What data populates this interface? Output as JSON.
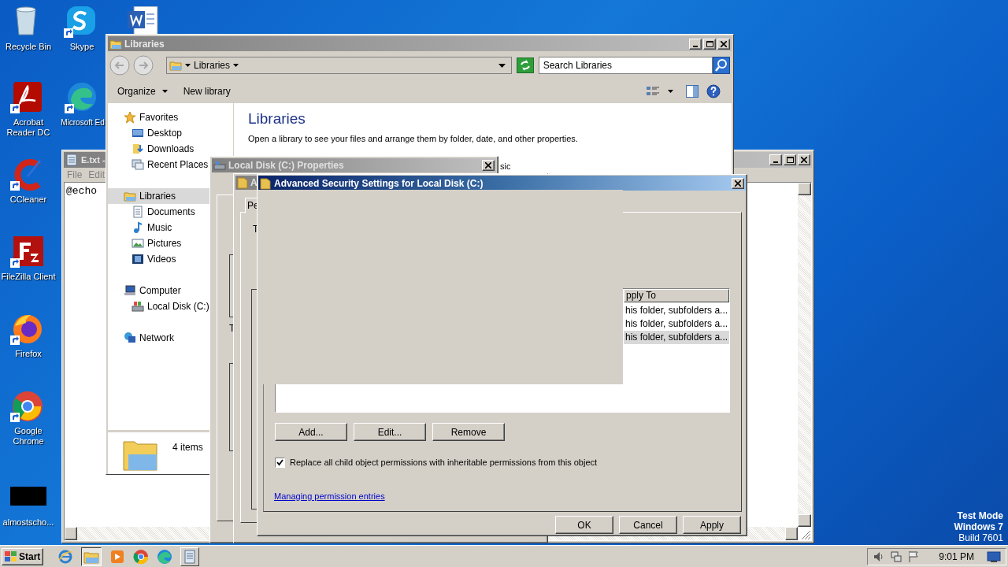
{
  "desktop_icons": [
    {
      "label": "Recycle Bin"
    },
    {
      "label": "Skype"
    },
    {
      "label": "Acrobat Reader DC"
    },
    {
      "label": "Microsoft Ed"
    },
    {
      "label": "CCleaner"
    },
    {
      "label": "FileZilla Client"
    },
    {
      "label": "Firefox"
    },
    {
      "label": "Google Chrome"
    },
    {
      "label": "almostscho..."
    }
  ],
  "notepad": {
    "title": "E.txt -",
    "menu": [
      "File",
      "Edit"
    ],
    "text": "@echo"
  },
  "explorer": {
    "title": "Libraries",
    "breadcrumb": "Libraries",
    "search": {
      "placeholder": "Search Libraries"
    },
    "toolbar": [
      "Organize",
      "New library"
    ],
    "nav": [
      {
        "label": "Favorites",
        "selected": false,
        "children": [
          {
            "label": "Desktop",
            "selected": false
          },
          {
            "label": "Downloads",
            "selected": false
          },
          {
            "label": "Recent Places",
            "selected": false
          }
        ]
      },
      {
        "label": "Libraries",
        "selected": true,
        "children": [
          {
            "label": "Documents",
            "selected": false
          },
          {
            "label": "Music",
            "selected": false
          },
          {
            "label": "Pictures",
            "selected": false
          },
          {
            "label": "Videos",
            "selected": false
          }
        ]
      },
      {
        "label": "Computer",
        "selected": false,
        "children": [
          {
            "label": "Local Disk (C:)",
            "selected": false
          }
        ]
      },
      {
        "label": "Network",
        "selected": false
      }
    ],
    "heading": "Libraries",
    "description": "Open a library to see your files and arrange them by folder, date, and other properties.",
    "content_fragment": "sic",
    "details": "4 items"
  },
  "properties_dialog": {
    "title": "Local Disk (C:) Properties",
    "fragments": [
      "T"
    ]
  },
  "middle_dialog": {
    "title": "A",
    "tab": "Pe",
    "fragments": [
      "T"
    ]
  },
  "advanced_dialog": {
    "title": "Advanced Security Settings for Local Disk (C:)",
    "column": "pply To",
    "rows": [
      {
        "apply_to": "his folder, subfolders a...",
        "selected": false
      },
      {
        "apply_to": "his folder, subfolders a...",
        "selected": false
      },
      {
        "apply_to": "his folder, subfolders a...",
        "selected": true
      }
    ],
    "buttons": [
      "Add...",
      "Edit...",
      "Remove"
    ],
    "replace_option": {
      "label": "Replace all child object permissions with inheritable permissions from this object",
      "checked": true
    },
    "link": "Managing permission entries",
    "footer_buttons": [
      "OK",
      "Cancel",
      "Apply"
    ]
  },
  "taskbar": {
    "start": "Start",
    "clock": "9:01 PM"
  },
  "os_notice": [
    "Test Mode",
    "Windows 7",
    "Build 7601"
  ]
}
